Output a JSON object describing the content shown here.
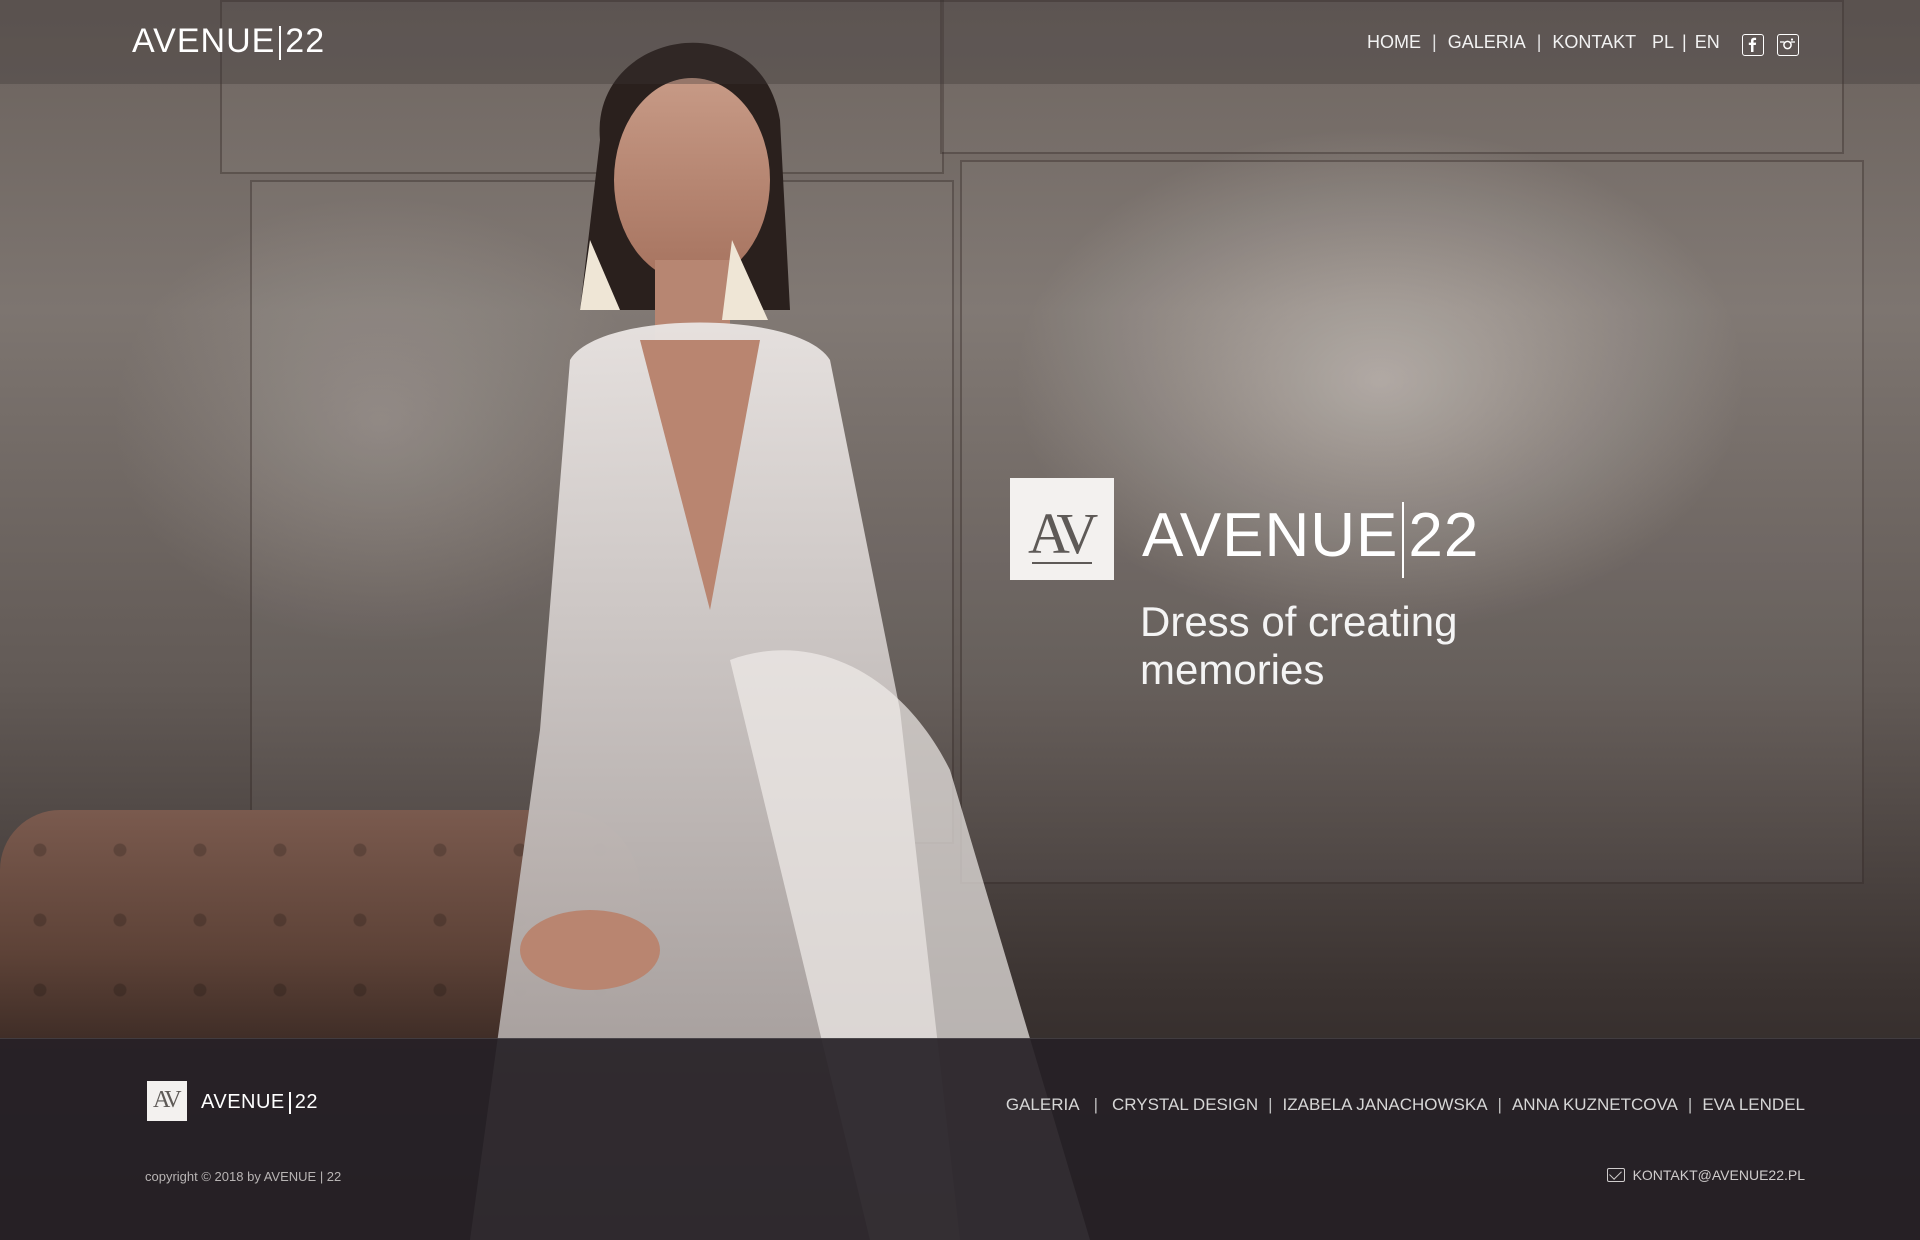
{
  "header": {
    "logo_left": "AVENUE",
    "logo_right": "22",
    "nav": [
      "HOME",
      "GALERIA",
      "KONTAKT"
    ],
    "languages": [
      "PL",
      "EN"
    ],
    "social_icons": [
      "facebook-icon",
      "instagram-icon"
    ]
  },
  "hero": {
    "mark": "AV",
    "brand_left": "AVENUE",
    "brand_right": "22",
    "tagline": "Dress of creating memories"
  },
  "footer": {
    "mark": "AV",
    "brand_left": "AVENUE",
    "brand_right": "22",
    "nav": [
      "GALERIA",
      "CRYSTAL DESIGN",
      "IZABELA JANACHOWSKA",
      "ANNA KUZNETCOVA",
      "EVA LENDEL"
    ],
    "copyright": "copyright © 2018 by AVENUE | 22",
    "email": "KONTAKT@AVENUE22.PL"
  },
  "colors": {
    "footer_bg": "#262126",
    "text": "#ffffff"
  }
}
